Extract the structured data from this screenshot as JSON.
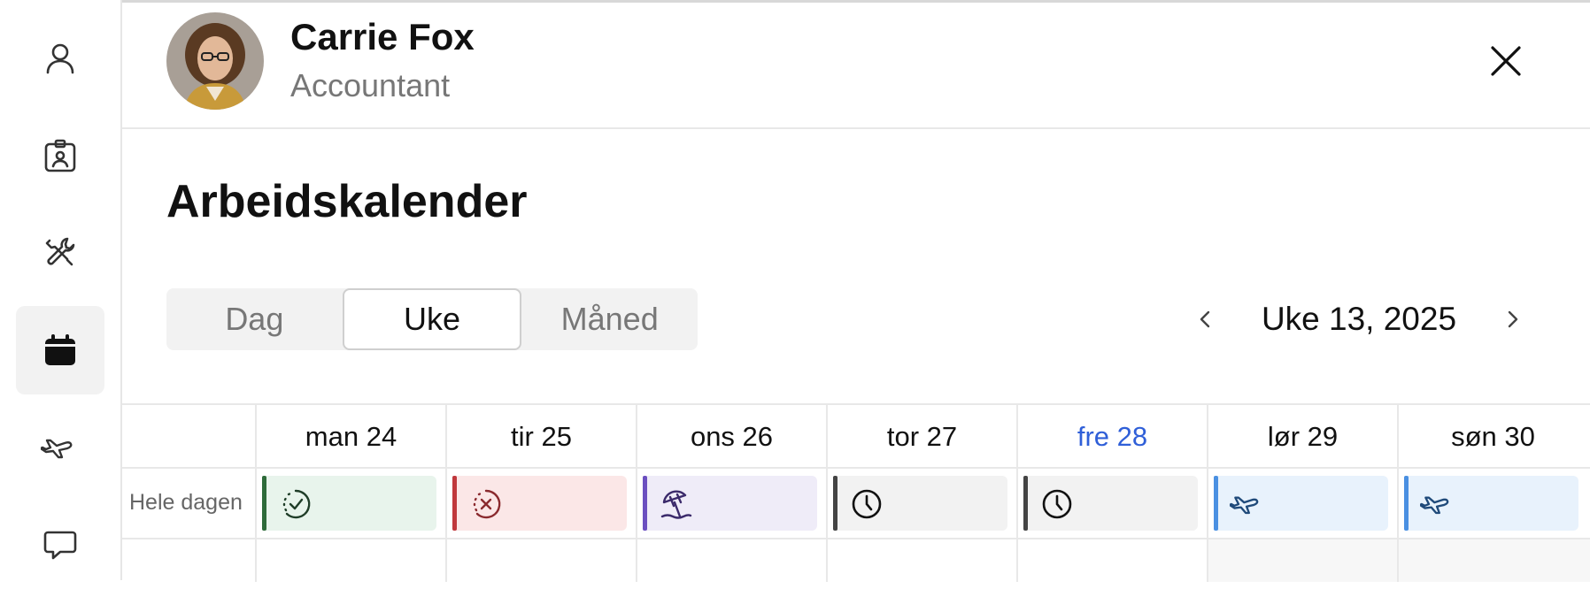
{
  "sidebar": {
    "items": [
      {
        "name": "person-icon",
        "active": false
      },
      {
        "name": "id-badge-icon",
        "active": false
      },
      {
        "name": "tools-icon",
        "active": false
      },
      {
        "name": "calendar-icon",
        "active": true
      },
      {
        "name": "airplane-icon",
        "active": false
      },
      {
        "name": "chat-bubble-icon",
        "active": false
      }
    ]
  },
  "header": {
    "name": "Carrie Fox",
    "role": "Accountant",
    "close_icon": "close-icon"
  },
  "page": {
    "title": "Arbeidskalender"
  },
  "view_toggle": {
    "options": [
      "Dag",
      "Uke",
      "Måned"
    ],
    "selected": "Uke"
  },
  "week_nav": {
    "label": "Uke 13, 2025",
    "prev_icon": "chevron-left-icon",
    "next_icon": "chevron-right-icon"
  },
  "calendar": {
    "all_day_label": "Hele dagen",
    "days": [
      {
        "label": "man 24",
        "today": false,
        "event": {
          "icon": "check-circle-icon",
          "bar": "#2e6b3a",
          "bg": "#e8f4ec"
        }
      },
      {
        "label": "tir 25",
        "today": false,
        "event": {
          "icon": "x-circle-icon",
          "bar": "#c0383c",
          "bg": "#fbe7e7"
        }
      },
      {
        "label": "ons 26",
        "today": false,
        "event": {
          "icon": "beach-umbrella-icon",
          "bar": "#6b4fc0",
          "bg": "#efecf8"
        }
      },
      {
        "label": "tor 27",
        "today": false,
        "event": {
          "icon": "clock-icon",
          "bar": "#444444",
          "bg": "#f2f2f2"
        }
      },
      {
        "label": "fre 28",
        "today": true,
        "event": {
          "icon": "clock-icon",
          "bar": "#444444",
          "bg": "#f2f2f2"
        }
      },
      {
        "label": "lør 29",
        "today": false,
        "event": {
          "icon": "airplane-icon",
          "bar": "#4a90e2",
          "bg": "#e8f2fc"
        }
      },
      {
        "label": "søn 30",
        "today": false,
        "event": {
          "icon": "airplane-icon",
          "bar": "#4a90e2",
          "bg": "#e8f2fc"
        }
      }
    ]
  },
  "colors": {
    "accent": "#2f5fd8",
    "muted_text": "#777777"
  }
}
